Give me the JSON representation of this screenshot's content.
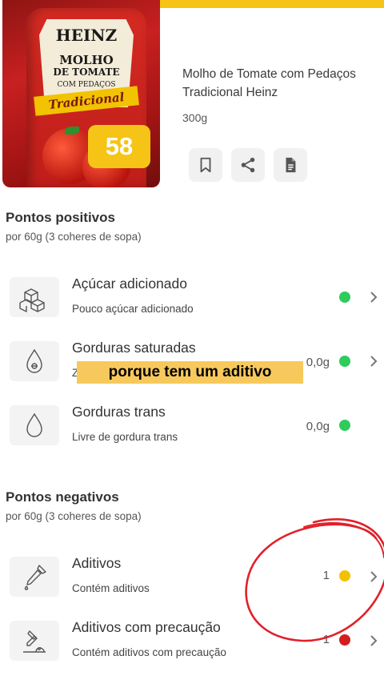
{
  "product": {
    "name": "Molho de Tomate com Pedaços Tradicional Heinz",
    "weight": "300g",
    "score": "58",
    "package": {
      "brand": "HEINZ",
      "line1": "MOLHO",
      "line2": "DE TOMATE",
      "line3": "COM PEDAÇOS",
      "variety": "Tradicional"
    }
  },
  "actions": [
    {
      "icon": "bookmark-icon"
    },
    {
      "icon": "share-icon"
    },
    {
      "icon": "document-icon"
    }
  ],
  "positives": {
    "title": "Pontos positivos",
    "portion": "por 60g (3 coheres de sopa)",
    "items": [
      {
        "title": "Açúcar adicionado",
        "desc": "Pouco açúcar adicionado",
        "value": "",
        "status_color": "#2ecc5c"
      },
      {
        "title": "Gorduras saturadas",
        "desc": "Ze",
        "value": "0,0g",
        "status_color": "#2ecc5c"
      },
      {
        "title": "Gorduras trans",
        "desc": "Livre de gordura trans",
        "value": "0,0g",
        "status_color": "#2ecc5c"
      }
    ]
  },
  "negatives": {
    "title": "Pontos negativos",
    "portion": "por 60g (3 coheres de sopa)",
    "items": [
      {
        "title": "Aditivos",
        "desc": "Contém aditivos",
        "value": "1",
        "status_color": "#f2c200"
      },
      {
        "title": "Aditivos com precaução",
        "desc": "Contém aditivos com precaução",
        "value": "1",
        "status_color": "#d11f1f"
      }
    ]
  },
  "caption": "porque tem um aditivo",
  "colors": {
    "accent": "#f6c416",
    "good": "#2ecc5c",
    "warning": "#f2c200",
    "bad": "#d11f1f",
    "annotation": "#e2202a"
  }
}
